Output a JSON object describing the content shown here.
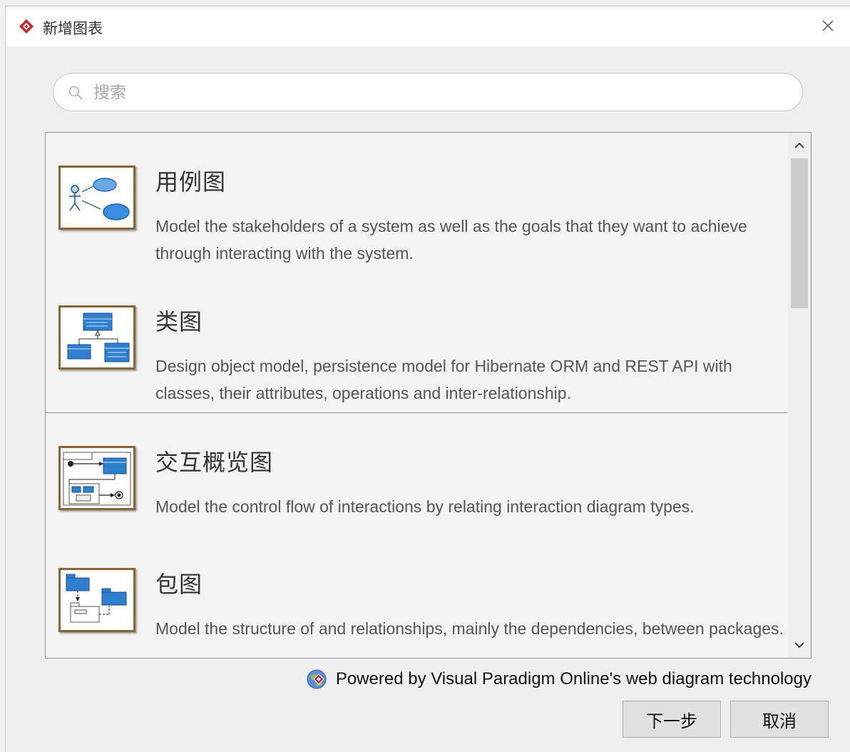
{
  "dialog": {
    "title": "新增图表",
    "colors": {
      "accent": "#c9252c",
      "thumb_border": "#8a6536",
      "uml_blue": "#2f7fd0"
    }
  },
  "search": {
    "placeholder": "搜索",
    "value": ""
  },
  "diagrams": [
    {
      "title": "用例图",
      "description": "Model the stakeholders of a system as well as the goals that they want to achieve through interacting with the system.",
      "icon": "use-case-diagram-icon"
    },
    {
      "title": "类图",
      "description": "Design object model, persistence model for Hibernate ORM and REST API with classes, their attributes, operations and inter-relationship.",
      "icon": "class-diagram-icon"
    },
    {
      "title": "交互概览图",
      "description": "Model the control flow of interactions by relating interaction diagram types.",
      "icon": "interaction-overview-diagram-icon"
    },
    {
      "title": "包图",
      "description": "Model the structure of and relationships, mainly the dependencies, between packages.",
      "icon": "package-diagram-icon"
    }
  ],
  "footer": {
    "powered_by": "Powered by Visual Paradigm Online's web diagram technology",
    "next_label": "下一步",
    "cancel_label": "取消"
  }
}
